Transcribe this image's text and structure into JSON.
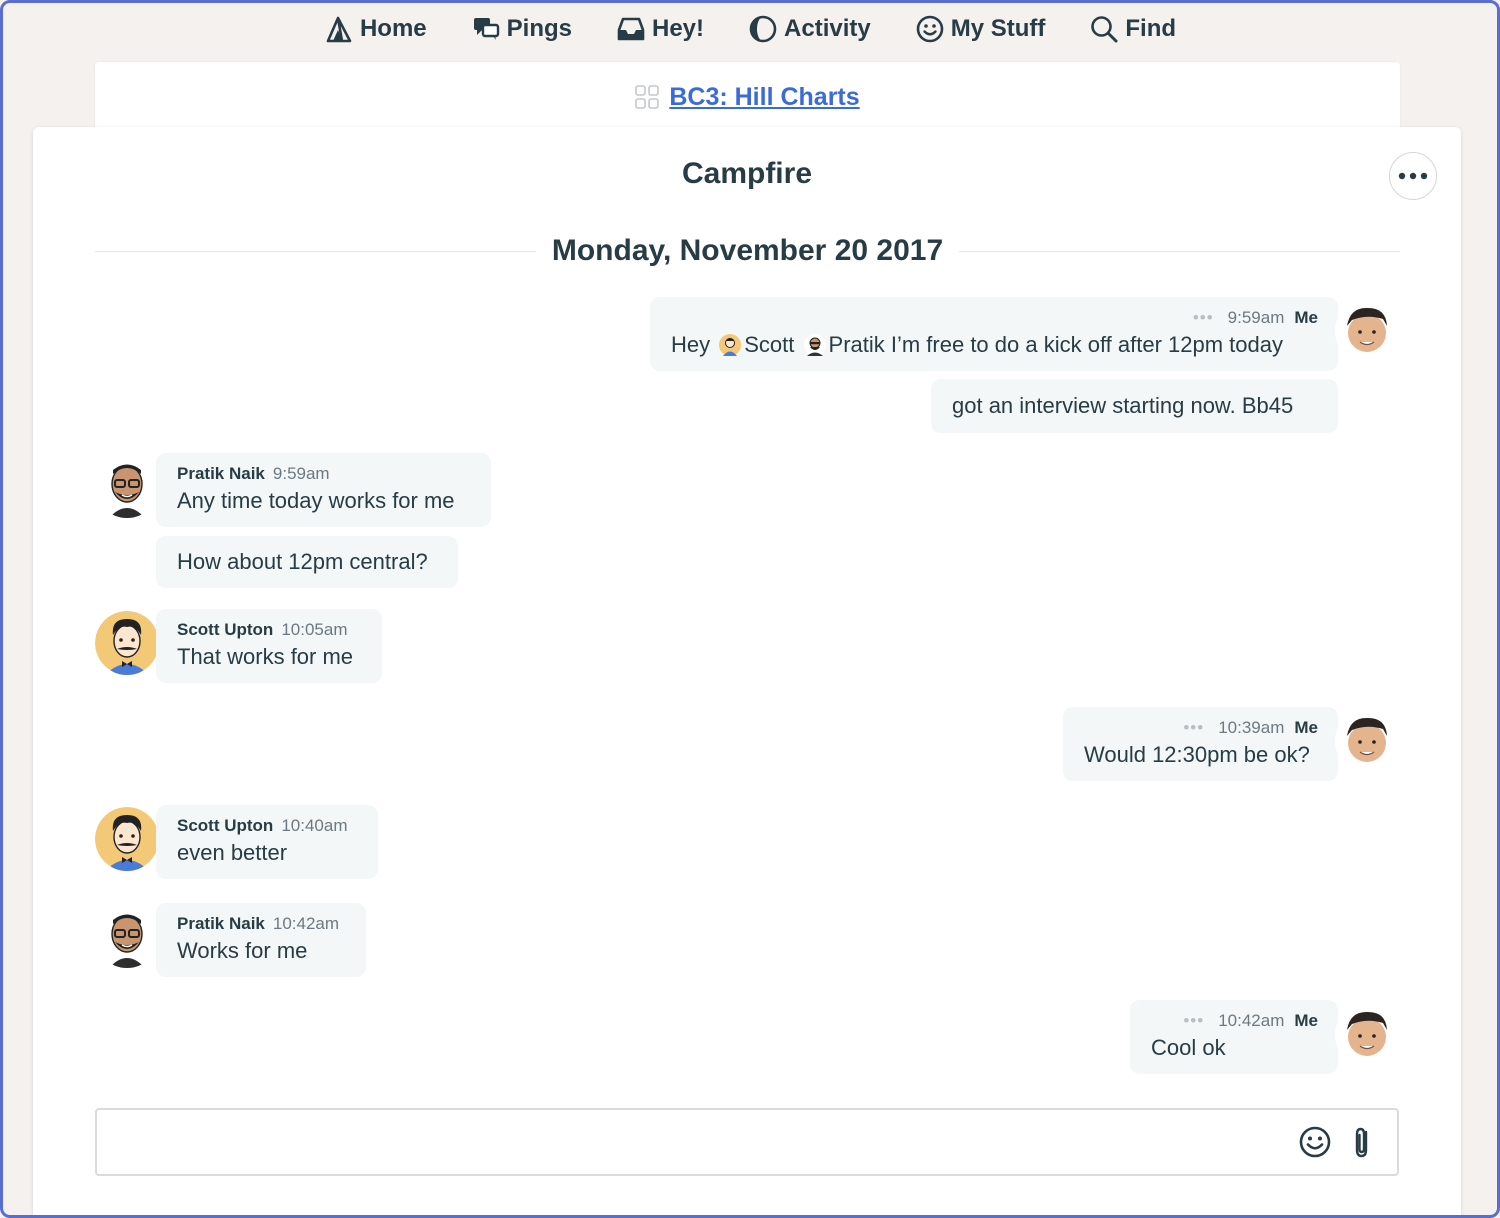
{
  "nav": {
    "items": [
      {
        "label": "Home",
        "icon": "home-tent-icon"
      },
      {
        "label": "Pings",
        "icon": "pings-chat-icon"
      },
      {
        "label": "Hey!",
        "icon": "hey-inbox-icon"
      },
      {
        "label": "Activity",
        "icon": "activity-icon"
      },
      {
        "label": "My Stuff",
        "icon": "smiley-face-icon"
      },
      {
        "label": "Find",
        "icon": "search-icon"
      }
    ]
  },
  "project": {
    "name": "BC3: Hill Charts"
  },
  "campfire": {
    "title": "Campfire",
    "date": "Monday, November 20 2017",
    "messages": [
      {
        "author": "Me",
        "time": "9:59am",
        "segments": [
          "Hey",
          "Scott",
          "Pratik I’m free to do a kick off after 12pm today"
        ]
      },
      {
        "author": "Me",
        "text": "got an interview starting now. Bb45"
      },
      {
        "author": "Pratik Naik",
        "time": "9:59am",
        "text": "Any time today works for me"
      },
      {
        "author": "Pratik Naik",
        "text": "How about 12pm central?"
      },
      {
        "author": "Scott Upton",
        "time": "10:05am",
        "text": "That works for me"
      },
      {
        "author": "Me",
        "time": "10:39am",
        "text": "Would 12:30pm be ok?"
      },
      {
        "author": "Scott Upton",
        "time": "10:40am",
        "text": "even better"
      },
      {
        "author": "Pratik Naik",
        "time": "10:42am",
        "text": "Works for me"
      },
      {
        "author": "Me",
        "time": "10:42am",
        "text": "Cool ok"
      }
    ],
    "dots": "•••"
  },
  "composer": {
    "placeholder": ""
  },
  "colors": {
    "accent": "#3b6bd6",
    "bubble": "#f3f7f7",
    "text": "#283c46"
  }
}
